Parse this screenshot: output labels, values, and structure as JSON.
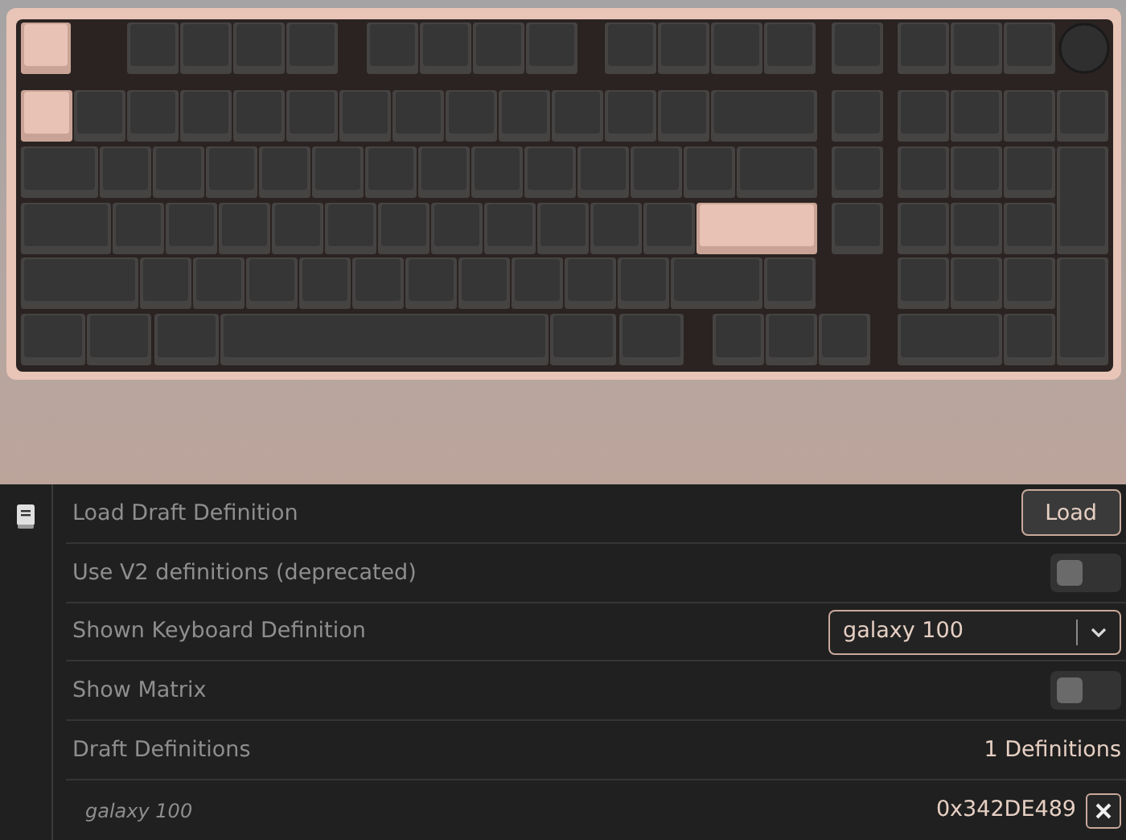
{
  "keyboard": {
    "rows": [
      [
        {
          "selected": true
        },
        {
          "selected": false
        },
        {
          "selected": false
        },
        {
          "selected": false
        },
        {
          "selected": false
        },
        {
          "selected": false
        },
        {
          "selected": false
        },
        {
          "selected": false
        },
        {
          "selected": false
        },
        {
          "selected": false
        },
        {
          "selected": false
        },
        {
          "selected": false
        },
        {
          "selected": false
        },
        {
          "selected": false
        },
        {
          "selected": false
        },
        {
          "selected": false
        },
        {
          "selected": false
        },
        {
          "kind": "knob",
          "selected": false
        }
      ],
      [
        {
          "selected": true
        },
        {
          "selected": false
        },
        {
          "selected": false
        },
        {
          "selected": false
        },
        {
          "selected": false
        },
        {
          "selected": false
        },
        {
          "selected": false
        },
        {
          "selected": false
        },
        {
          "selected": false
        },
        {
          "selected": false
        },
        {
          "selected": false
        },
        {
          "selected": false
        },
        {
          "selected": false
        },
        {
          "selected": false
        },
        {
          "selected": false
        },
        {
          "selected": false
        },
        {
          "selected": false
        },
        {
          "selected": false
        },
        {
          "selected": false
        }
      ],
      [
        {
          "selected": false
        },
        {
          "selected": false
        },
        {
          "selected": false
        },
        {
          "selected": false
        },
        {
          "selected": false
        },
        {
          "selected": false
        },
        {
          "selected": false
        },
        {
          "selected": false
        },
        {
          "selected": false
        },
        {
          "selected": false
        },
        {
          "selected": false
        },
        {
          "selected": false
        },
        {
          "selected": false
        },
        {
          "selected": false
        },
        {
          "selected": false
        },
        {
          "selected": false
        },
        {
          "selected": false
        },
        {
          "selected": false
        },
        {
          "selected": false
        }
      ],
      [
        {
          "selected": false
        },
        {
          "selected": false
        },
        {
          "selected": false
        },
        {
          "selected": false
        },
        {
          "selected": false
        },
        {
          "selected": false
        },
        {
          "selected": false
        },
        {
          "selected": false
        },
        {
          "selected": false
        },
        {
          "selected": false
        },
        {
          "selected": false
        },
        {
          "selected": false
        },
        {
          "selected": true
        },
        {
          "selected": false
        },
        {
          "selected": false
        },
        {
          "selected": false
        },
        {
          "selected": false
        }
      ],
      [
        {
          "selected": false
        },
        {
          "selected": false
        },
        {
          "selected": false
        },
        {
          "selected": false
        },
        {
          "selected": false
        },
        {
          "selected": false
        },
        {
          "selected": false
        },
        {
          "selected": false
        },
        {
          "selected": false
        },
        {
          "selected": false
        },
        {
          "selected": false
        },
        {
          "selected": false
        },
        {
          "selected": false
        },
        {
          "selected": false
        },
        {
          "selected": false
        },
        {
          "selected": false
        },
        {
          "selected": false
        }
      ],
      [
        {
          "selected": false
        },
        {
          "selected": false
        },
        {
          "selected": false
        },
        {
          "selected": false
        },
        {
          "selected": false
        },
        {
          "selected": false
        },
        {
          "selected": false
        },
        {
          "selected": false
        },
        {
          "selected": false
        },
        {
          "selected": false
        },
        {
          "selected": false
        }
      ]
    ]
  },
  "settings": [
    {
      "kind": "button",
      "label": "Load Draft Definition",
      "button": "Load"
    },
    {
      "kind": "toggle",
      "label": "Use V2 definitions (deprecated)",
      "on": false
    },
    {
      "kind": "select",
      "label": "Shown Keyboard Definition",
      "value": "galaxy 100"
    },
    {
      "kind": "toggle",
      "label": "Show Matrix",
      "on": false
    },
    {
      "kind": "text",
      "label": "Draft Definitions",
      "value": "1 Definitions"
    },
    {
      "kind": "definition",
      "label": "galaxy 100",
      "value": "0x342DE489"
    }
  ]
}
